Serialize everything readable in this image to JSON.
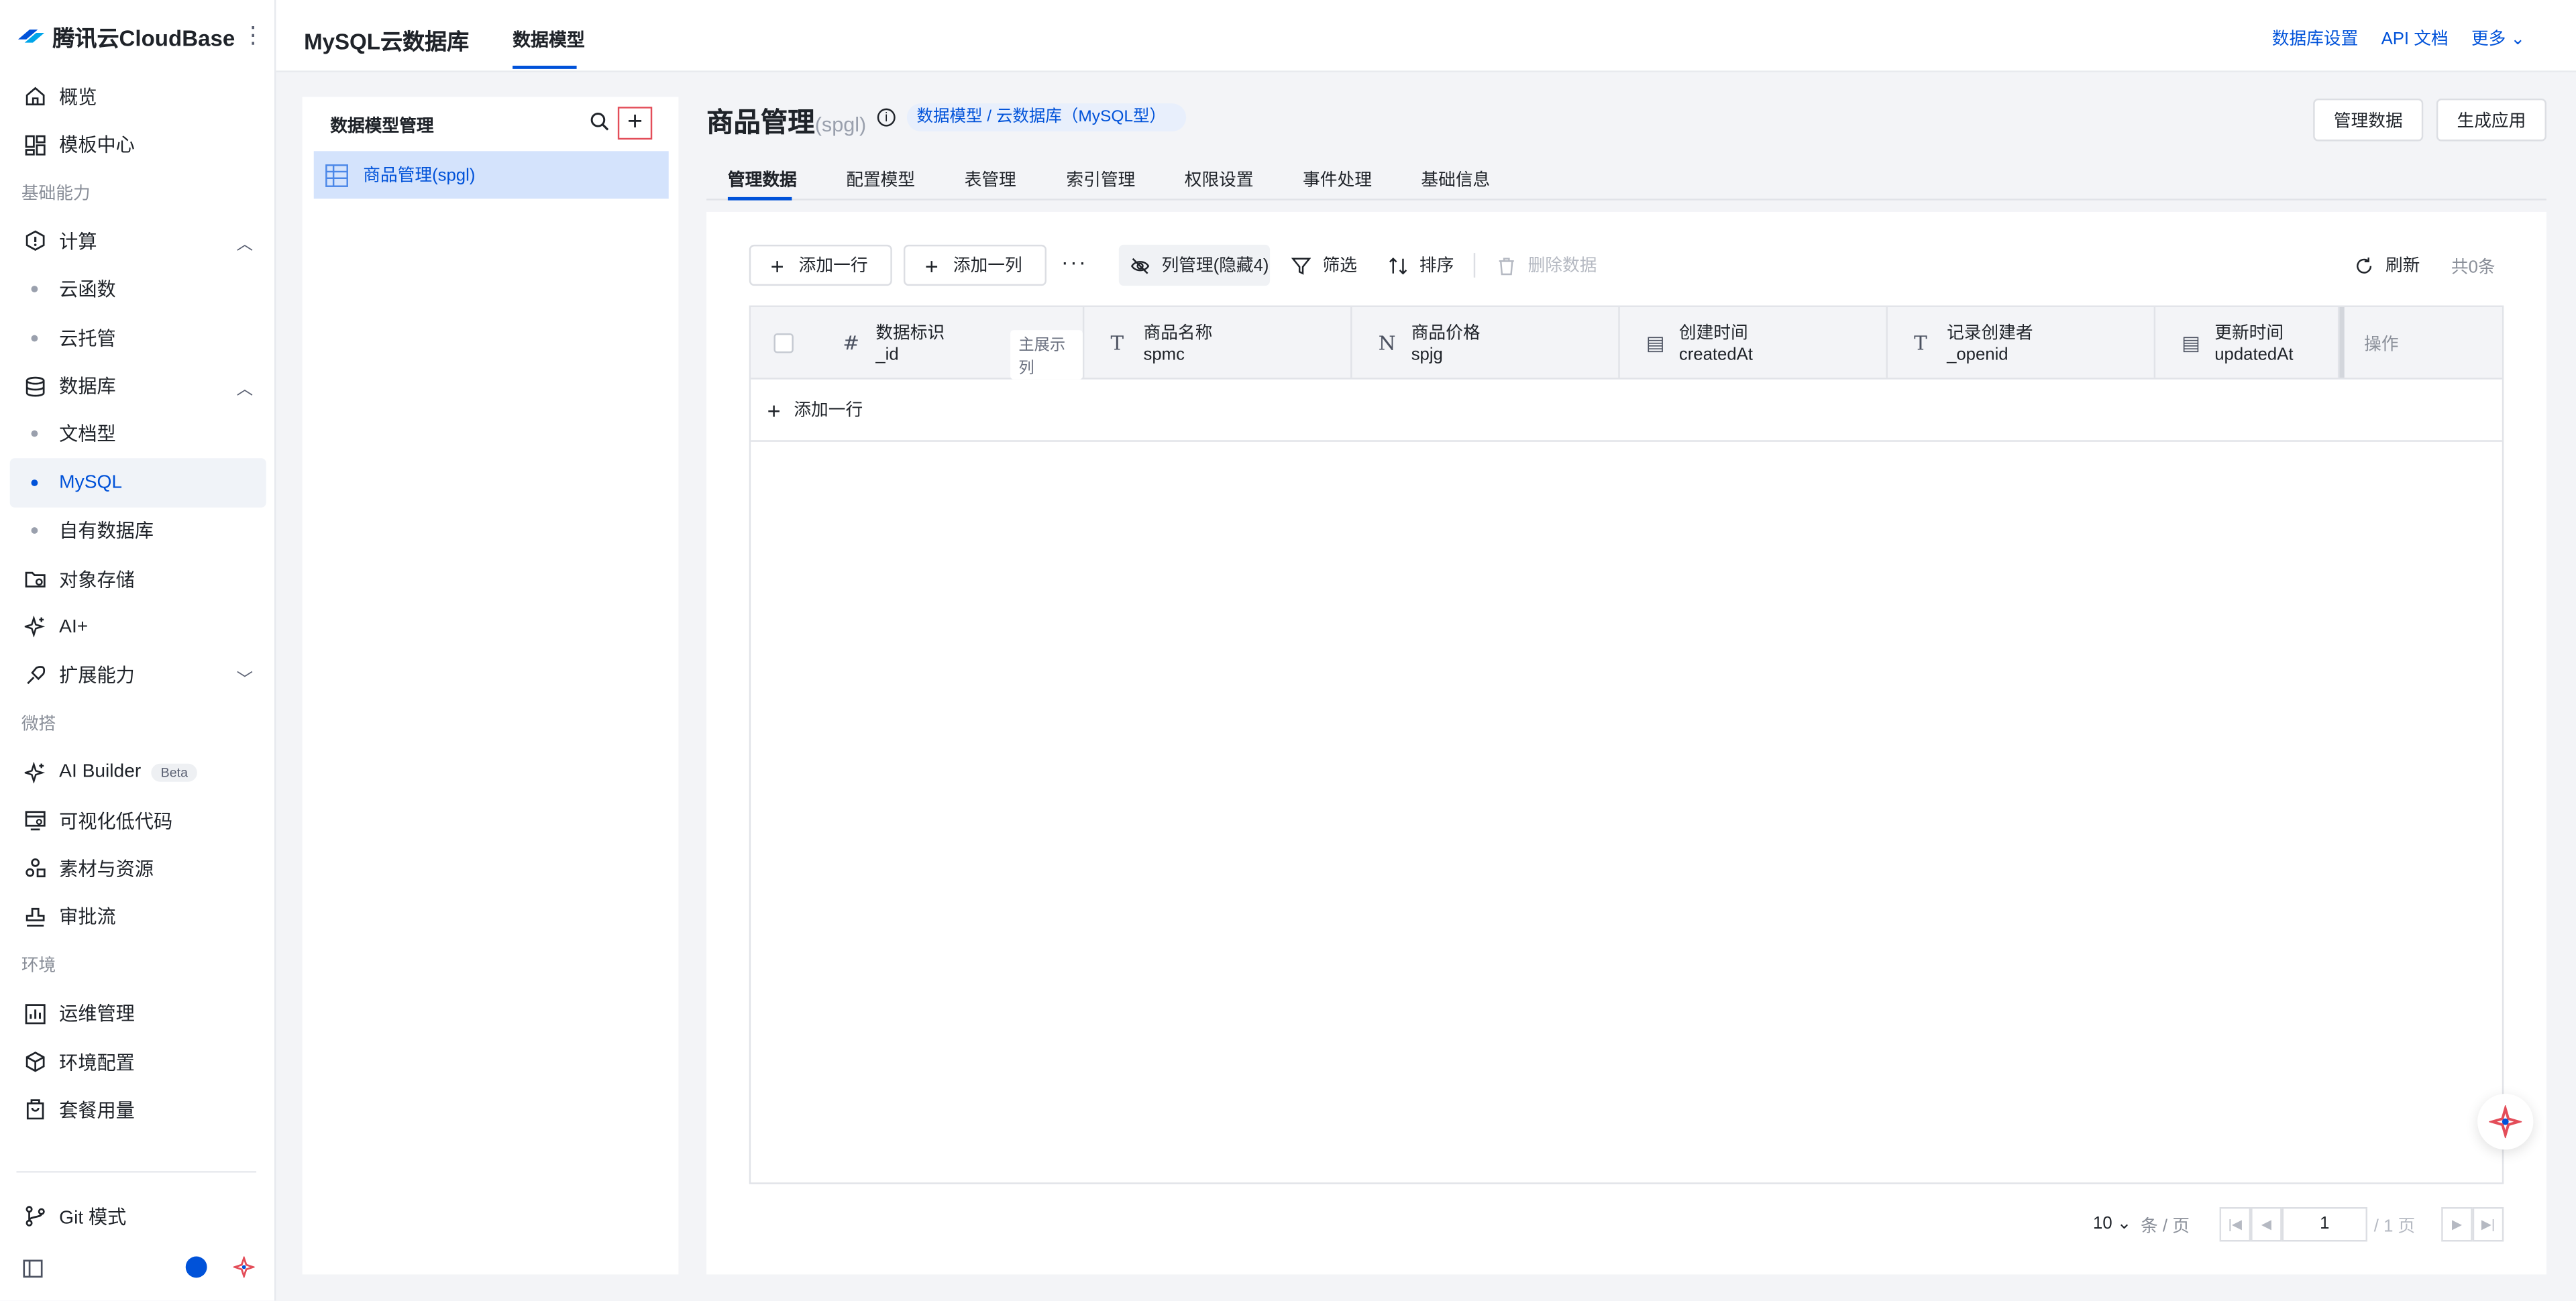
{
  "brand": {
    "name": "腾讯云CloudBase",
    "more_icon": "more-vertical-icon"
  },
  "sidebar": {
    "items": [
      {
        "type": "item",
        "label": "概览",
        "icon": "home-icon"
      },
      {
        "type": "item",
        "label": "模板中心",
        "icon": "grid-icon"
      },
      {
        "type": "group",
        "label": "基础能力"
      },
      {
        "type": "item",
        "label": "计算",
        "icon": "compute-icon",
        "caret": "up"
      },
      {
        "type": "sub",
        "label": "云函数"
      },
      {
        "type": "sub",
        "label": "云托管"
      },
      {
        "type": "item",
        "label": "数据库",
        "icon": "database-icon",
        "caret": "up"
      },
      {
        "type": "sub",
        "label": "文档型"
      },
      {
        "type": "sub",
        "label": "MySQL",
        "active": true
      },
      {
        "type": "sub",
        "label": "自有数据库"
      },
      {
        "type": "item",
        "label": "对象存储",
        "icon": "storage-icon"
      },
      {
        "type": "item",
        "label": "AI+",
        "icon": "sparkle-icon"
      },
      {
        "type": "item",
        "label": "扩展能力",
        "icon": "extension-icon",
        "caret": "down"
      },
      {
        "type": "group",
        "label": "微搭"
      },
      {
        "type": "item",
        "label": "AI Builder",
        "icon": "sparkle-icon",
        "badge": "Beta"
      },
      {
        "type": "item",
        "label": "可视化低代码",
        "icon": "lowcode-icon"
      },
      {
        "type": "item",
        "label": "素材与资源",
        "icon": "assets-icon"
      },
      {
        "type": "item",
        "label": "审批流",
        "icon": "approval-icon"
      },
      {
        "type": "group",
        "label": "环境"
      },
      {
        "type": "item",
        "label": "运维管理",
        "icon": "chart-icon"
      },
      {
        "type": "item",
        "label": "环境配置",
        "icon": "cube-icon"
      },
      {
        "type": "item",
        "label": "套餐用量",
        "icon": "package-icon"
      }
    ],
    "git_label": "Git 模式"
  },
  "topbar": {
    "title": "MySQL云数据库",
    "tab": "数据模型",
    "links": [
      "数据库设置",
      "API 文档",
      "更多"
    ]
  },
  "model_panel": {
    "title": "数据模型管理",
    "item": "商品管理(spgl)"
  },
  "page": {
    "title": "商品管理",
    "subtitle": "(spgl)",
    "badge": "数据模型 / 云数据库（MySQL型）",
    "btn_manage": "管理数据",
    "btn_generate": "生成应用"
  },
  "tabs": [
    "管理数据",
    "配置模型",
    "表管理",
    "索引管理",
    "权限设置",
    "事件处理",
    "基础信息"
  ],
  "toolbar": {
    "add_row": "添加一行",
    "add_col": "添加一列",
    "more": "···",
    "col_manage": "列管理(隐藏4)",
    "filter": "筛选",
    "sort": "排序",
    "delete": "删除数据",
    "refresh": "刷新",
    "total": "共0条"
  },
  "table": {
    "columns": [
      {
        "icon": "#",
        "name": "数据标识",
        "field": "_id",
        "tag": "主展示列"
      },
      {
        "icon": "T",
        "name": "商品名称",
        "field": "spmc"
      },
      {
        "icon": "N",
        "name": "商品价格",
        "field": "spjg"
      },
      {
        "icon": "▤",
        "name": "创建时间",
        "field": "createdAt"
      },
      {
        "icon": "T",
        "name": "记录创建者",
        "field": "_openid"
      },
      {
        "icon": "▤",
        "name": "更新时间",
        "field": "updatedAt"
      }
    ],
    "op_label": "操作",
    "add_row": "添加一行"
  },
  "pager": {
    "page_size": "10",
    "unit": "条 / 页",
    "current": "1",
    "of": "/ 1 页"
  },
  "colors": {
    "accent": "#0052d9",
    "selected_bg": "#d4e3fc",
    "highlight_border": "#e34d59"
  }
}
